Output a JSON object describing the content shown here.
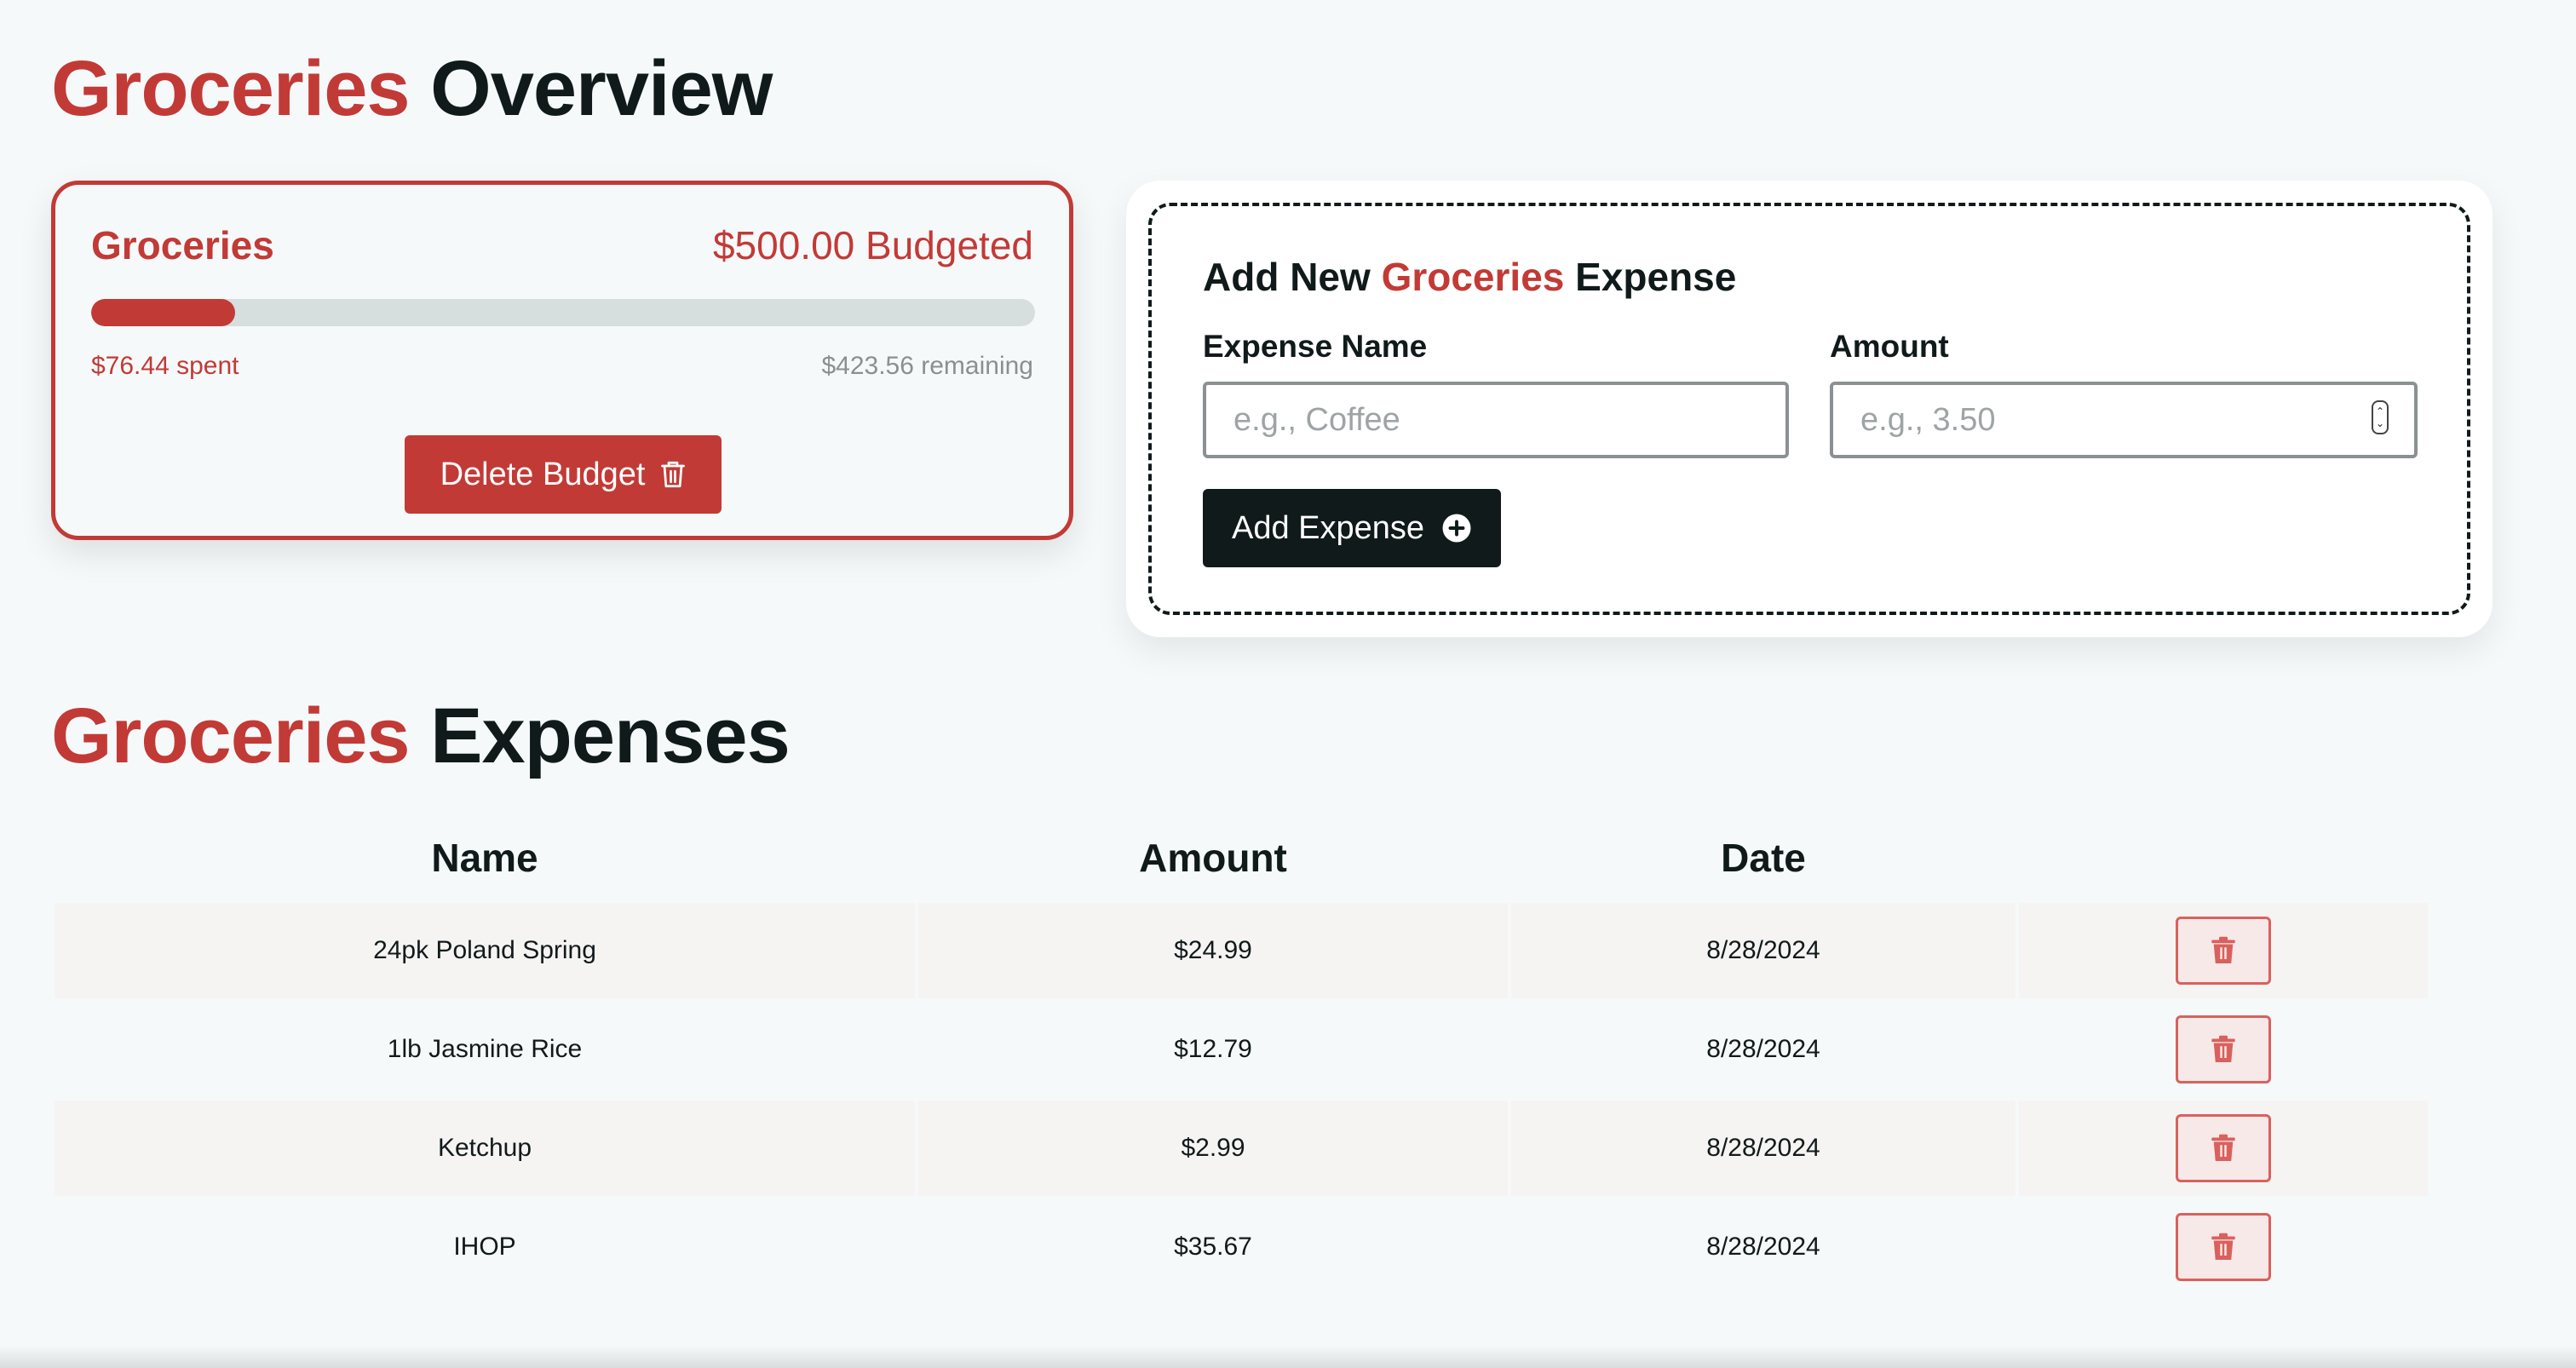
{
  "overview": {
    "title_accent": "Groceries",
    "title_rest": "Overview"
  },
  "budget": {
    "name": "Groceries",
    "budgeted_label": "$500.00 Budgeted",
    "spent_label": "$76.44 spent",
    "remaining_label": "$423.56 remaining",
    "spent": 76.44,
    "total": 500,
    "delete_label": "Delete Budget"
  },
  "form": {
    "title_prefix": "Add New",
    "title_accent": "Groceries",
    "title_suffix": "Expense",
    "name_label": "Expense Name",
    "name_placeholder": "e.g., Coffee",
    "amount_label": "Amount",
    "amount_placeholder": "e.g., 3.50",
    "submit_label": "Add Expense"
  },
  "expenses": {
    "title_accent": "Groceries",
    "title_rest": "Expenses",
    "columns": [
      "Name",
      "Amount",
      "Date"
    ],
    "rows": [
      {
        "name": "24pk Poland Spring",
        "amount": "$24.99",
        "date": "8/28/2024"
      },
      {
        "name": "1lb Jasmine Rice",
        "amount": "$12.79",
        "date": "8/28/2024"
      },
      {
        "name": "Ketchup",
        "amount": "$2.99",
        "date": "8/28/2024"
      },
      {
        "name": "IHOP",
        "amount": "$35.67",
        "date": "8/28/2024"
      }
    ]
  },
  "colors": {
    "accent": "#c23a36",
    "dark": "#111a1b",
    "track": "#d6dede",
    "background": "#f6f9fa"
  },
  "icons": {
    "delete_budget": "trash-icon",
    "add_expense": "plus-circle-icon",
    "row_delete": "trash-icon"
  }
}
